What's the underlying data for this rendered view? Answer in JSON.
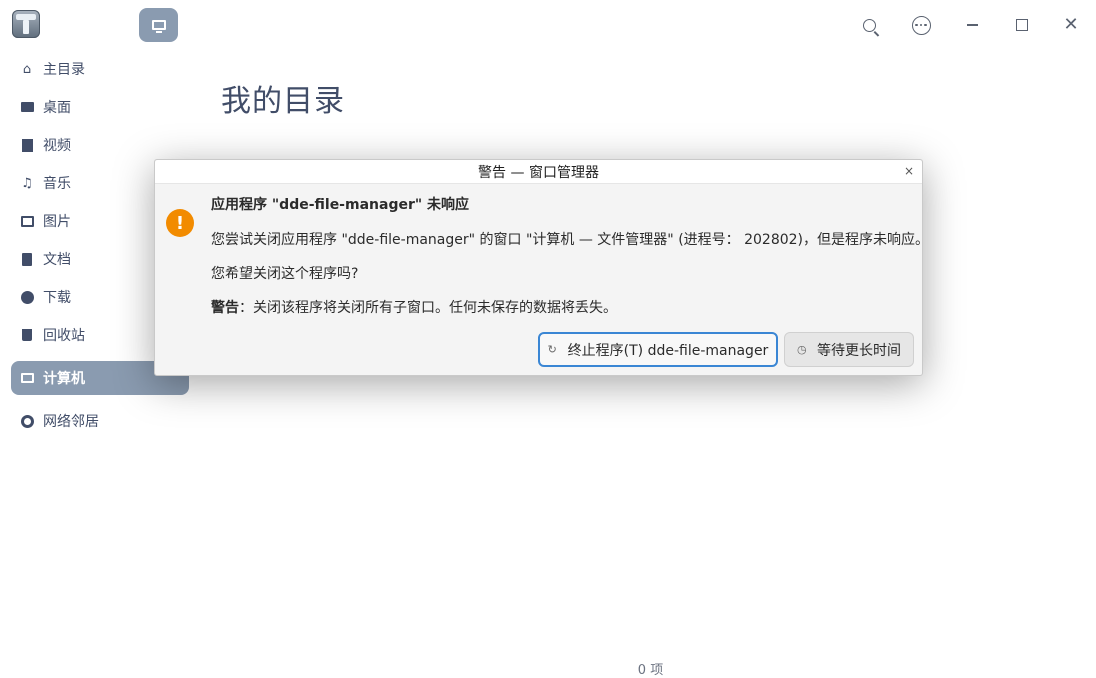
{
  "titlebar": {
    "icons": [
      "app-logo-icon",
      "computer-icon",
      "search-icon",
      "more-icon",
      "minimize-icon",
      "maximize-icon",
      "close-icon"
    ],
    "close_glyph": "✕"
  },
  "sidebar": {
    "items": [
      {
        "label": "主目录",
        "icon": "home-icon"
      },
      {
        "label": "桌面",
        "icon": "desktop-icon"
      },
      {
        "label": "视频",
        "icon": "video-icon"
      },
      {
        "label": "音乐",
        "icon": "music-icon"
      },
      {
        "label": "图片",
        "icon": "picture-icon"
      },
      {
        "label": "文档",
        "icon": "document-icon"
      },
      {
        "label": "下载",
        "icon": "download-icon"
      },
      {
        "label": "回收站",
        "icon": "trash-icon"
      },
      {
        "label": "计算机",
        "icon": "computer-icon",
        "active": true
      },
      {
        "label": "网络邻居",
        "icon": "network-icon"
      }
    ]
  },
  "main": {
    "title": "我的目录",
    "status": "0 项"
  },
  "dialog": {
    "title": "警告 — 窗口管理器",
    "close": "×",
    "heading": "应用程序 \"dde-file-manager\" 未响应",
    "body": "您尝试关闭应用程序 \"dde-file-manager\" 的窗口 \"计算机 — 文件管理器\" (进程号： 202802)，但是程序未响应。",
    "question": "您希望关闭这个程序吗?",
    "warning_label": "警告",
    "warning_text": "：关闭该程序将关闭所有子窗口。任何未保存的数据将丢失。",
    "kill_button": "终止程序(T) dde-file-manager",
    "wait_button": "等待更长时间"
  },
  "colors": {
    "accent": "#8a9bb0",
    "focus": "#3a86d4",
    "warning": "#f28b00"
  }
}
